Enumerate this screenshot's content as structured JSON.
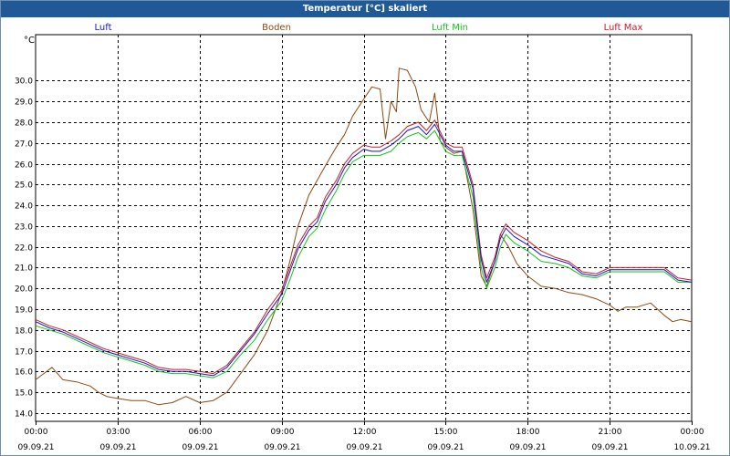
{
  "window": {
    "title": "Temperatur [°C] skaliert"
  },
  "legend": [
    {
      "label": "Luft",
      "color": "#1515c8"
    },
    {
      "label": "Boden",
      "color": "#8b4a10"
    },
    {
      "label": "Luft Min",
      "color": "#17c417"
    },
    {
      "label": "Luft Max",
      "color": "#cc1a2a"
    }
  ],
  "unit": "°C",
  "chart_data": {
    "type": "line",
    "title": "Temperatur [°C] skaliert",
    "ylabel": "°C",
    "ylim": [
      13.6,
      31.6
    ],
    "y_ticks": [
      "14.0",
      "15.0",
      "16.0",
      "17.0",
      "18.0",
      "19.0",
      "20.0",
      "21.0",
      "22.0",
      "23.0",
      "24.0",
      "25.0",
      "26.0",
      "27.0",
      "28.0",
      "29.0",
      "30.0"
    ],
    "x_ticks": [
      {
        "time": "00:00",
        "date": "09.09.21"
      },
      {
        "time": "03:00",
        "date": "09.09.21"
      },
      {
        "time": "06:00",
        "date": "09.09.21"
      },
      {
        "time": "09:00",
        "date": "09.09.21"
      },
      {
        "time": "12:00",
        "date": "09.09.21"
      },
      {
        "time": "15:00",
        "date": "09.09.21"
      },
      {
        "time": "18:00",
        "date": "09.09.21"
      },
      {
        "time": "21:00",
        "date": "09.09.21"
      },
      {
        "time": "00:00",
        "date": "10.09.21"
      }
    ],
    "x_unit": "hours",
    "xlim": [
      0,
      24
    ],
    "grid": true,
    "series": [
      {
        "name": "Luft",
        "color": "#1515c8",
        "points": [
          [
            0,
            18.4
          ],
          [
            0.5,
            18.1
          ],
          [
            1,
            17.9
          ],
          [
            1.5,
            17.6
          ],
          [
            2,
            17.3
          ],
          [
            2.5,
            17.0
          ],
          [
            3,
            16.8
          ],
          [
            3.5,
            16.6
          ],
          [
            4,
            16.4
          ],
          [
            4.5,
            16.1
          ],
          [
            5,
            16.0
          ],
          [
            5.5,
            16.0
          ],
          [
            6,
            15.9
          ],
          [
            6.5,
            15.8
          ],
          [
            7,
            16.2
          ],
          [
            7.5,
            17.0
          ],
          [
            8,
            17.8
          ],
          [
            8.5,
            18.8
          ],
          [
            9,
            19.7
          ],
          [
            9.3,
            20.8
          ],
          [
            9.6,
            21.9
          ],
          [
            10,
            22.8
          ],
          [
            10.3,
            23.2
          ],
          [
            10.6,
            24.2
          ],
          [
            11,
            25.0
          ],
          [
            11.3,
            25.8
          ],
          [
            11.6,
            26.3
          ],
          [
            12,
            26.7
          ],
          [
            12.3,
            26.6
          ],
          [
            12.6,
            26.6
          ],
          [
            13,
            26.9
          ],
          [
            13.3,
            27.2
          ],
          [
            13.6,
            27.6
          ],
          [
            14,
            27.8
          ],
          [
            14.3,
            27.4
          ],
          [
            14.6,
            27.9
          ],
          [
            15,
            26.9
          ],
          [
            15.3,
            26.6
          ],
          [
            15.6,
            26.6
          ],
          [
            16,
            24.8
          ],
          [
            16.3,
            21.4
          ],
          [
            16.5,
            20.3
          ],
          [
            16.8,
            21.3
          ],
          [
            17,
            22.4
          ],
          [
            17.2,
            22.9
          ],
          [
            17.5,
            22.5
          ],
          [
            18,
            22.1
          ],
          [
            18.5,
            21.6
          ],
          [
            19,
            21.4
          ],
          [
            19.5,
            21.2
          ],
          [
            20,
            20.7
          ],
          [
            20.5,
            20.6
          ],
          [
            21,
            20.9
          ],
          [
            21.5,
            20.9
          ],
          [
            22,
            20.9
          ],
          [
            22.5,
            20.9
          ],
          [
            23,
            20.9
          ],
          [
            23.5,
            20.4
          ],
          [
            24,
            20.3
          ]
        ]
      },
      {
        "name": "Boden",
        "color": "#8b4a10",
        "points": [
          [
            0,
            15.6
          ],
          [
            0.3,
            15.9
          ],
          [
            0.6,
            16.2
          ],
          [
            1,
            15.6
          ],
          [
            1.5,
            15.5
          ],
          [
            2,
            15.3
          ],
          [
            2.3,
            15.0
          ],
          [
            2.6,
            14.8
          ],
          [
            3,
            14.7
          ],
          [
            3.5,
            14.6
          ],
          [
            4,
            14.6
          ],
          [
            4.5,
            14.4
          ],
          [
            5,
            14.5
          ],
          [
            5.5,
            14.8
          ],
          [
            6,
            14.5
          ],
          [
            6.5,
            14.6
          ],
          [
            7,
            15.0
          ],
          [
            7.5,
            15.9
          ],
          [
            8,
            16.8
          ],
          [
            8.5,
            18.0
          ],
          [
            9,
            19.8
          ],
          [
            9.3,
            21.3
          ],
          [
            9.6,
            23.0
          ],
          [
            10,
            24.5
          ],
          [
            10.3,
            25.2
          ],
          [
            10.6,
            25.9
          ],
          [
            11,
            26.8
          ],
          [
            11.3,
            27.4
          ],
          [
            11.6,
            28.3
          ],
          [
            12,
            29.1
          ],
          [
            12.3,
            29.7
          ],
          [
            12.6,
            29.6
          ],
          [
            12.8,
            27.2
          ],
          [
            13,
            29.0
          ],
          [
            13.2,
            28.5
          ],
          [
            13.3,
            30.6
          ],
          [
            13.6,
            30.5
          ],
          [
            13.9,
            29.7
          ],
          [
            14.1,
            28.6
          ],
          [
            14.4,
            28.0
          ],
          [
            14.6,
            29.4
          ],
          [
            14.8,
            27.1
          ],
          [
            15,
            26.8
          ],
          [
            15.3,
            26.5
          ],
          [
            15.6,
            26.6
          ],
          [
            16,
            23.8
          ],
          [
            16.3,
            20.6
          ],
          [
            16.5,
            20.1
          ],
          [
            16.8,
            21.3
          ],
          [
            17,
            22.6
          ],
          [
            17.3,
            22.0
          ],
          [
            17.6,
            21.2
          ],
          [
            18,
            20.6
          ],
          [
            18.5,
            20.1
          ],
          [
            19,
            20.0
          ],
          [
            19.5,
            19.8
          ],
          [
            20,
            19.7
          ],
          [
            20.5,
            19.5
          ],
          [
            21,
            19.2
          ],
          [
            21.3,
            18.9
          ],
          [
            21.6,
            19.1
          ],
          [
            22,
            19.1
          ],
          [
            22.5,
            19.3
          ],
          [
            23,
            18.7
          ],
          [
            23.3,
            18.4
          ],
          [
            23.6,
            18.5
          ],
          [
            24,
            18.4
          ]
        ]
      },
      {
        "name": "Luft Min",
        "color": "#17c417",
        "points": [
          [
            0,
            18.2
          ],
          [
            0.5,
            18.0
          ],
          [
            1,
            17.8
          ],
          [
            1.5,
            17.5
          ],
          [
            2,
            17.2
          ],
          [
            2.5,
            16.9
          ],
          [
            3,
            16.7
          ],
          [
            3.5,
            16.5
          ],
          [
            4,
            16.3
          ],
          [
            4.5,
            16.0
          ],
          [
            5,
            15.9
          ],
          [
            5.5,
            15.9
          ],
          [
            6,
            15.8
          ],
          [
            6.5,
            15.7
          ],
          [
            7,
            16.0
          ],
          [
            7.5,
            16.8
          ],
          [
            8,
            17.5
          ],
          [
            8.5,
            18.5
          ],
          [
            9,
            19.4
          ],
          [
            9.3,
            20.4
          ],
          [
            9.6,
            21.5
          ],
          [
            10,
            22.5
          ],
          [
            10.3,
            22.9
          ],
          [
            10.6,
            23.8
          ],
          [
            11,
            24.7
          ],
          [
            11.3,
            25.5
          ],
          [
            11.6,
            26.1
          ],
          [
            12,
            26.4
          ],
          [
            12.3,
            26.4
          ],
          [
            12.6,
            26.4
          ],
          [
            13,
            26.6
          ],
          [
            13.3,
            27.0
          ],
          [
            13.6,
            27.3
          ],
          [
            14,
            27.5
          ],
          [
            14.3,
            27.2
          ],
          [
            14.6,
            27.6
          ],
          [
            15,
            26.6
          ],
          [
            15.3,
            26.4
          ],
          [
            15.6,
            26.4
          ],
          [
            16,
            24.4
          ],
          [
            16.3,
            21.0
          ],
          [
            16.5,
            20.0
          ],
          [
            16.8,
            21.0
          ],
          [
            17,
            22.0
          ],
          [
            17.2,
            22.6
          ],
          [
            17.5,
            22.2
          ],
          [
            18,
            21.8
          ],
          [
            18.5,
            21.3
          ],
          [
            19,
            21.2
          ],
          [
            19.5,
            21.0
          ],
          [
            20,
            20.6
          ],
          [
            20.5,
            20.5
          ],
          [
            21,
            20.8
          ],
          [
            21.5,
            20.8
          ],
          [
            22,
            20.8
          ],
          [
            22.5,
            20.8
          ],
          [
            23,
            20.8
          ],
          [
            23.5,
            20.3
          ],
          [
            24,
            20.3
          ]
        ]
      },
      {
        "name": "Luft Max",
        "color": "#cc1a2a",
        "points": [
          [
            0,
            18.5
          ],
          [
            0.5,
            18.2
          ],
          [
            1,
            18.0
          ],
          [
            1.5,
            17.7
          ],
          [
            2,
            17.4
          ],
          [
            2.5,
            17.1
          ],
          [
            3,
            16.9
          ],
          [
            3.5,
            16.7
          ],
          [
            4,
            16.5
          ],
          [
            4.5,
            16.2
          ],
          [
            5,
            16.1
          ],
          [
            5.5,
            16.1
          ],
          [
            6,
            16.0
          ],
          [
            6.5,
            15.9
          ],
          [
            7,
            16.3
          ],
          [
            7.5,
            17.1
          ],
          [
            8,
            17.9
          ],
          [
            8.5,
            19.0
          ],
          [
            9,
            19.9
          ],
          [
            9.3,
            21.0
          ],
          [
            9.6,
            22.1
          ],
          [
            10,
            23.0
          ],
          [
            10.3,
            23.4
          ],
          [
            10.6,
            24.4
          ],
          [
            11,
            25.2
          ],
          [
            11.3,
            26.0
          ],
          [
            11.6,
            26.5
          ],
          [
            12,
            26.9
          ],
          [
            12.3,
            26.8
          ],
          [
            12.6,
            26.8
          ],
          [
            13,
            27.1
          ],
          [
            13.3,
            27.4
          ],
          [
            13.6,
            27.8
          ],
          [
            14,
            28.0
          ],
          [
            14.3,
            27.6
          ],
          [
            14.6,
            28.1
          ],
          [
            15,
            27.0
          ],
          [
            15.3,
            26.8
          ],
          [
            15.6,
            26.8
          ],
          [
            16,
            25.0
          ],
          [
            16.3,
            21.6
          ],
          [
            16.5,
            20.5
          ],
          [
            16.8,
            21.5
          ],
          [
            17,
            22.6
          ],
          [
            17.2,
            23.1
          ],
          [
            17.5,
            22.7
          ],
          [
            18,
            22.3
          ],
          [
            18.5,
            21.8
          ],
          [
            19,
            21.5
          ],
          [
            19.5,
            21.3
          ],
          [
            20,
            20.8
          ],
          [
            20.5,
            20.7
          ],
          [
            21,
            21.0
          ],
          [
            21.5,
            21.0
          ],
          [
            22,
            21.0
          ],
          [
            22.5,
            21.0
          ],
          [
            23,
            21.0
          ],
          [
            23.5,
            20.5
          ],
          [
            24,
            20.4
          ]
        ]
      }
    ]
  }
}
